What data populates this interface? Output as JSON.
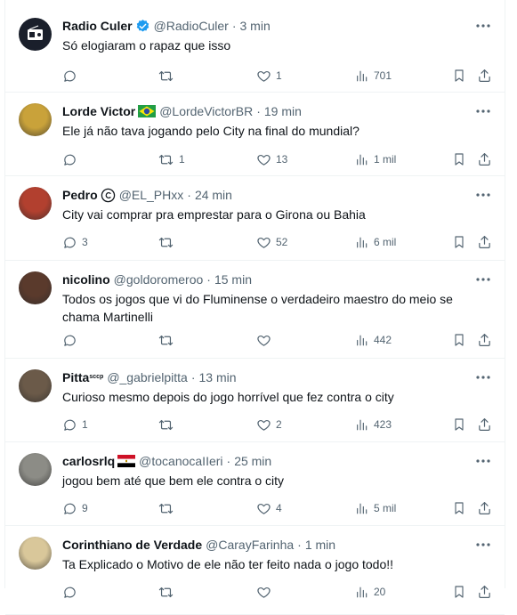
{
  "tweets": [
    {
      "name": "Radio Culer",
      "handle": "@RadioCuler",
      "time": "3 min",
      "text": "Só elogiaram o rapaz que isso",
      "replies": "",
      "retweets": "",
      "likes": "1",
      "views": "701",
      "badge": "verified-icon",
      "avatar_color": "#1a1f2b"
    },
    {
      "name": "Lorde Victor",
      "handle": "@LordeVictorBR",
      "time": "19 min",
      "text": "Ele já não tava jogando pelo City na final do mundial?",
      "replies": "",
      "retweets": "1",
      "likes": "13",
      "views": "1 mil",
      "badge": "brazil-flag-icon",
      "avatar_color": "#c9a23a"
    },
    {
      "name": "Pedro",
      "handle": "@EL_PHxx",
      "time": "24 min",
      "text": "City vai comprar pra emprestar para o Girona ou Bahia",
      "replies": "3",
      "retweets": "",
      "likes": "52",
      "views": "6 mil",
      "badge": "copyright-icon",
      "avatar_color": "#b2402f"
    },
    {
      "name": "nicolino",
      "handle": "@goldoromeroo",
      "time": "15 min",
      "text": "Todos os jogos que vi do Fluminense o verdadeiro maestro do meio se chama Martinelli",
      "replies": "",
      "retweets": "",
      "likes": "",
      "views": "442",
      "badge": "",
      "avatar_color": "#5a3a2c"
    },
    {
      "name": "Pitta",
      "name_suffix": "sccp",
      "handle": "@_gabrielpitta",
      "time": "13 min",
      "text": "Curioso mesmo depois do jogo horrível que fez contra o city",
      "replies": "1",
      "retweets": "",
      "likes": "2",
      "views": "423",
      "badge": "",
      "avatar_color": "#6b5a49"
    },
    {
      "name": "carlosrlq",
      "handle": "@tocanocaIIeri",
      "time": "25 min",
      "text": "jogou bem até que bem ele contra o city",
      "replies": "9",
      "retweets": "",
      "likes": "4",
      "views": "5 mil",
      "badge": "egypt-flag-icon",
      "avatar_color": "#8c8c86"
    },
    {
      "name": "Corinthiano de Verdade",
      "handle": "@CarayFarinha",
      "time": "1 min",
      "text": "Ta Explicado o Motivo de ele não ter feito nada o jogo todo!!",
      "replies": "",
      "retweets": "",
      "likes": "",
      "views": "20",
      "badge": "",
      "avatar_color": "#d9c79a"
    }
  ],
  "colors": {
    "text": "#0f1419",
    "muted": "#536471",
    "border": "#eff3f4",
    "verified": "#1d9bf0"
  },
  "icons": [
    "reply-icon",
    "retweet-icon",
    "like-icon",
    "views-icon",
    "bookmark-icon",
    "share-icon",
    "more-icon"
  ]
}
